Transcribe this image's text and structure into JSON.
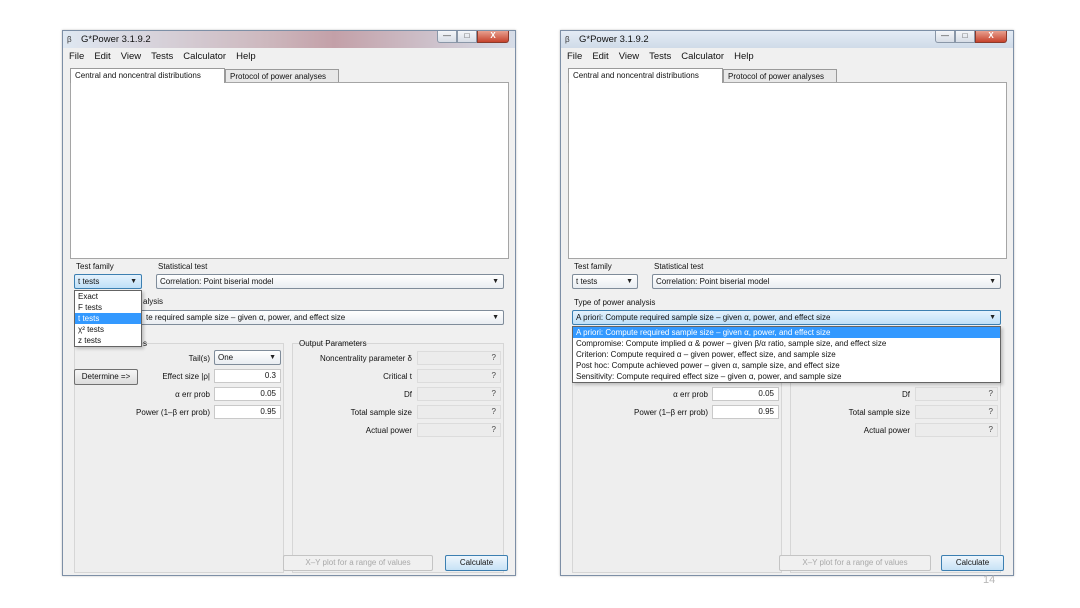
{
  "window": {
    "title": "G*Power 3.1.9.2",
    "controls": [
      "—",
      "□",
      "X"
    ]
  },
  "menu": [
    "File",
    "Edit",
    "View",
    "Tests",
    "Calculator",
    "Help"
  ],
  "tabs": [
    "Central and noncentral distributions",
    "Protocol of power analyses"
  ],
  "test_family": {
    "label": "Test family",
    "value": "t tests",
    "options": [
      "Exact",
      "F tests",
      "t tests",
      "χ² tests",
      "z tests"
    ]
  },
  "statistical_test": {
    "label": "Statistical test",
    "value": "Correlation: Point biserial model"
  },
  "power_analysis": {
    "label": "Type of power analysis",
    "label_visible_left": "alysis",
    "value": "A priori: Compute required sample size – given α, power, and effect size",
    "value_visible_left": "te required sample size – given α, power, and effect size",
    "options": [
      "A priori: Compute required sample size – given α, power, and effect size",
      "Compromise: Compute implied α & power – given β/α ratio, sample size, and effect size",
      "Criterion: Compute required α – given power, effect size, and sample size",
      "Post hoc: Compute achieved power – given α, sample size, and effect size",
      "Sensitivity: Compute required effect size – given α, power, and sample size"
    ]
  },
  "input": {
    "header_fragment": "s",
    "tails_label": "Tail(s)",
    "tails_value": "One",
    "determine_label": "Determine =>",
    "effect_label": "Effect size |ρ|",
    "effect_value": "0.3",
    "alpha_label": "α err prob",
    "alpha_value": "0.05",
    "power_label": "Power (1–β err prob)",
    "power_value": "0.95"
  },
  "output": {
    "header": "Output Parameters",
    "rows": [
      {
        "label": "Noncentrality parameter δ",
        "value": "?"
      },
      {
        "label": "Critical t",
        "value": "?"
      },
      {
        "label": "Df",
        "value": "?"
      },
      {
        "label": "Total sample size",
        "value": "?"
      },
      {
        "label": "Actual power",
        "value": "?"
      }
    ]
  },
  "buttons": {
    "xy_plot": "X–Y plot for a range of values",
    "calculate": "Calculate"
  },
  "page_number": "14"
}
